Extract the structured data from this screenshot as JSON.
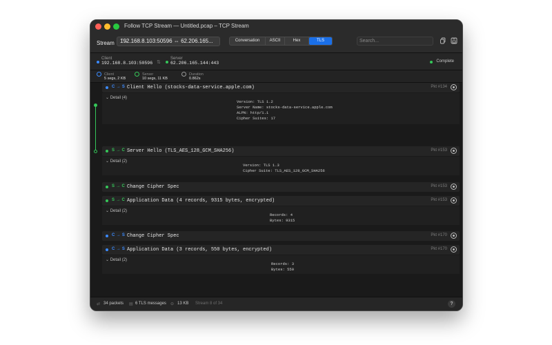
{
  "window": {
    "title": "Follow TCP Stream — Untitled.pcap – TCP Stream"
  },
  "toolbar": {
    "stream_label": "Stream",
    "stream_value": "192.168.8.103:50596 ⇔ 62.206.165...",
    "modes": [
      "Conversation",
      "ASCII",
      "Hex",
      "TLS"
    ],
    "active_mode": "TLS",
    "search_placeholder": "Search...",
    "icons": [
      "copy-icon",
      "save-icon"
    ]
  },
  "endpoints": {
    "client_label": "Client",
    "client_value": "192.168.8.103:50596",
    "server_label": "Server",
    "server_value": "62.206.165.144:443",
    "status": "Complete"
  },
  "stats": {
    "client_label": "Client",
    "client_value": "5 segs, 2 KB",
    "server_label": "Server",
    "server_value": "10 segs, 11 KB",
    "duration_label": "Duration",
    "duration_value": "0.862s"
  },
  "messages": [
    {
      "dir": "C → S",
      "dir_color": "#3b8bff",
      "label": "Client Hello (stocks-data-service.apple.com)",
      "packet": "Pkt #134",
      "detail_label": "Detail (4)",
      "detail": [
        "Version: TLS 1.2",
        "Server Name: stocks-data-service.apple.com",
        "ALPN: http/1.1",
        "Cipher Suites: 17"
      ]
    },
    {
      "dir": "S → C",
      "dir_color": "#35c759",
      "label": "Server Hello (TLS_AES_128_GCM_SHA256)",
      "packet": "Pkt #153",
      "detail_label": "Detail (2)",
      "detail": [
        "Version: TLS 1.3",
        "Cipher Suite: TLS_AES_128_GCM_SHA256"
      ]
    },
    {
      "dir": "S → C",
      "dir_color": "#35c759",
      "label": "Change Cipher Spec",
      "packet": "Pkt #153"
    },
    {
      "dir": "S → C",
      "dir_color": "#35c759",
      "label": "Application Data (4 records, 9315 bytes, encrypted)",
      "packet": "Pkt #153",
      "detail_label": "Detail (2)",
      "detail": [
        "Records: 4",
        "Bytes: 9315"
      ]
    },
    {
      "dir": "C → S",
      "dir_color": "#3b8bff",
      "label": "Change Cipher Spec",
      "packet": "Pkt #170"
    },
    {
      "dir": "C → S",
      "dir_color": "#3b8bff",
      "label": "Application Data (3 records, 550 bytes, encrypted)",
      "packet": "Pkt #170",
      "detail_label": "Detail (2)",
      "detail": [
        "Records: 3",
        "Bytes: 550"
      ]
    }
  ],
  "footer": {
    "packets": "34 packets",
    "tls_messages": "6 TLS messages",
    "size": "13 KB",
    "stream": "Stream 8 of 34",
    "help": "?"
  }
}
